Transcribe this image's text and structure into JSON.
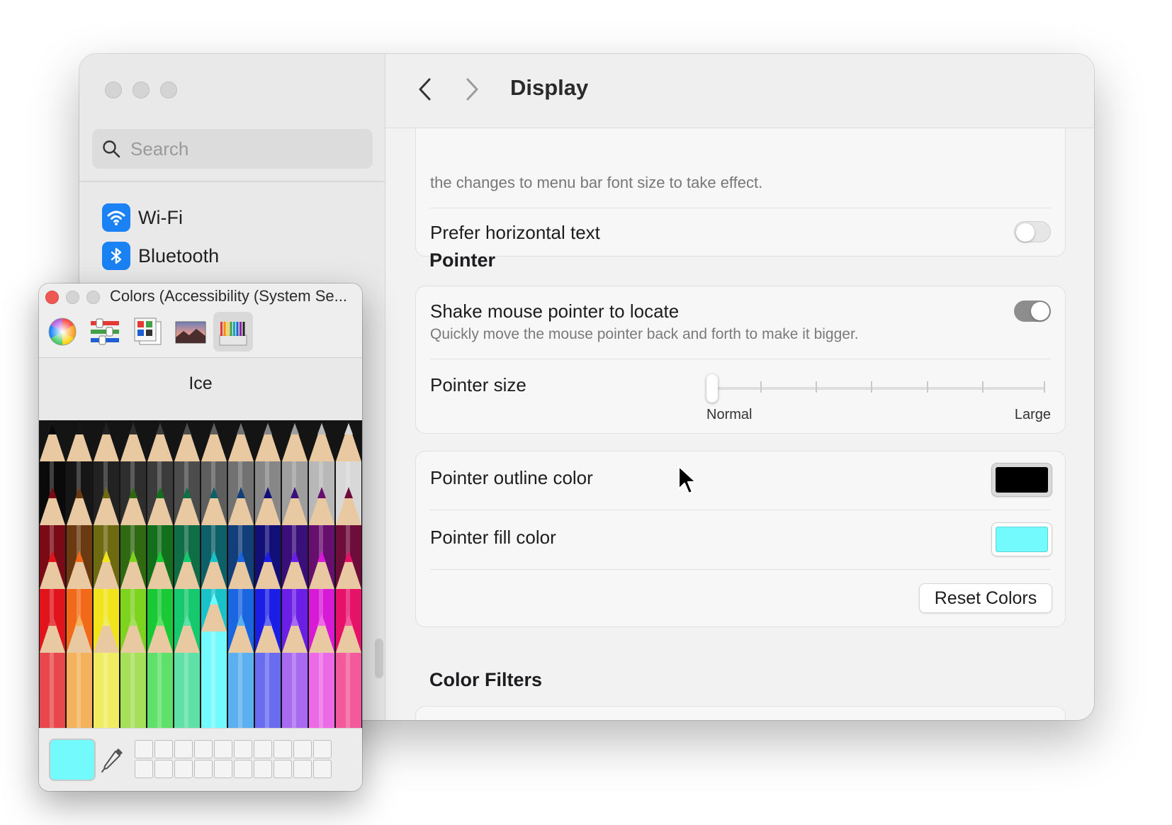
{
  "sidebar": {
    "search_placeholder": "Search",
    "items": [
      {
        "label": "Wi-Fi",
        "icon": "wifi-icon"
      },
      {
        "label": "Bluetooth",
        "icon": "bluetooth-icon"
      }
    ]
  },
  "header": {
    "title": "Display",
    "back_icon": "chevron-left-icon",
    "forward_icon": "chevron-right-icon"
  },
  "content": {
    "truncated_text": "the changes to menu bar font size to take effect.",
    "prefer_horizontal": {
      "label": "Prefer horizontal text",
      "enabled": false
    },
    "pointer_section": "Pointer",
    "shake": {
      "label": "Shake mouse pointer to locate",
      "description": "Quickly move the mouse pointer back and forth to make it bigger.",
      "enabled": true
    },
    "pointer_size": {
      "label": "Pointer size",
      "min_label": "Normal",
      "max_label": "Large",
      "value": 0,
      "steps": 7
    },
    "outline_color": {
      "label": "Pointer outline color",
      "color": "#000000"
    },
    "fill_color": {
      "label": "Pointer fill color",
      "color": "#73fafd"
    },
    "reset_button": "Reset Colors",
    "color_filters_section": "Color Filters"
  },
  "colors_panel": {
    "title": "Colors (Accessibility (System Se...",
    "tools": [
      "color-wheel-icon",
      "color-sliders-icon",
      "color-palettes-icon",
      "image-palettes-icon",
      "pencils-icon"
    ],
    "selected_tool": "pencils-icon",
    "selected_color_name": "Ice",
    "current_color": "#73fafd",
    "pencil_rows": [
      [
        "#0a0a0a",
        "#161616",
        "#222222",
        "#2e2e2e",
        "#3c3c3c",
        "#4c4c4c",
        "#5e5e5e",
        "#727272",
        "#878787",
        "#9e9e9e",
        "#b8b8b8",
        "#d8d8d8"
      ],
      [
        "#7a0b16",
        "#6b3a10",
        "#6e6a12",
        "#2f6a12",
        "#12701c",
        "#0f6e46",
        "#0e6068",
        "#123e7a",
        "#130f78",
        "#3a0f7a",
        "#660f6e",
        "#6e0c3a"
      ],
      [
        "#e0141a",
        "#f2691a",
        "#f2e41c",
        "#7ed320",
        "#19c936",
        "#17c96e",
        "#18c2c8",
        "#1a66e0",
        "#1b1fe6",
        "#6b1ee6",
        "#d61ad6",
        "#e6126a"
      ],
      [
        "#e8484c",
        "#f4b25c",
        "#f0ec62",
        "#a6e05a",
        "#5fe06a",
        "#5ee0a6",
        "#73fafd",
        "#5cb0f0",
        "#6a6cf0",
        "#a86af0",
        "#ec6ae6",
        "#f25a9c"
      ]
    ]
  }
}
